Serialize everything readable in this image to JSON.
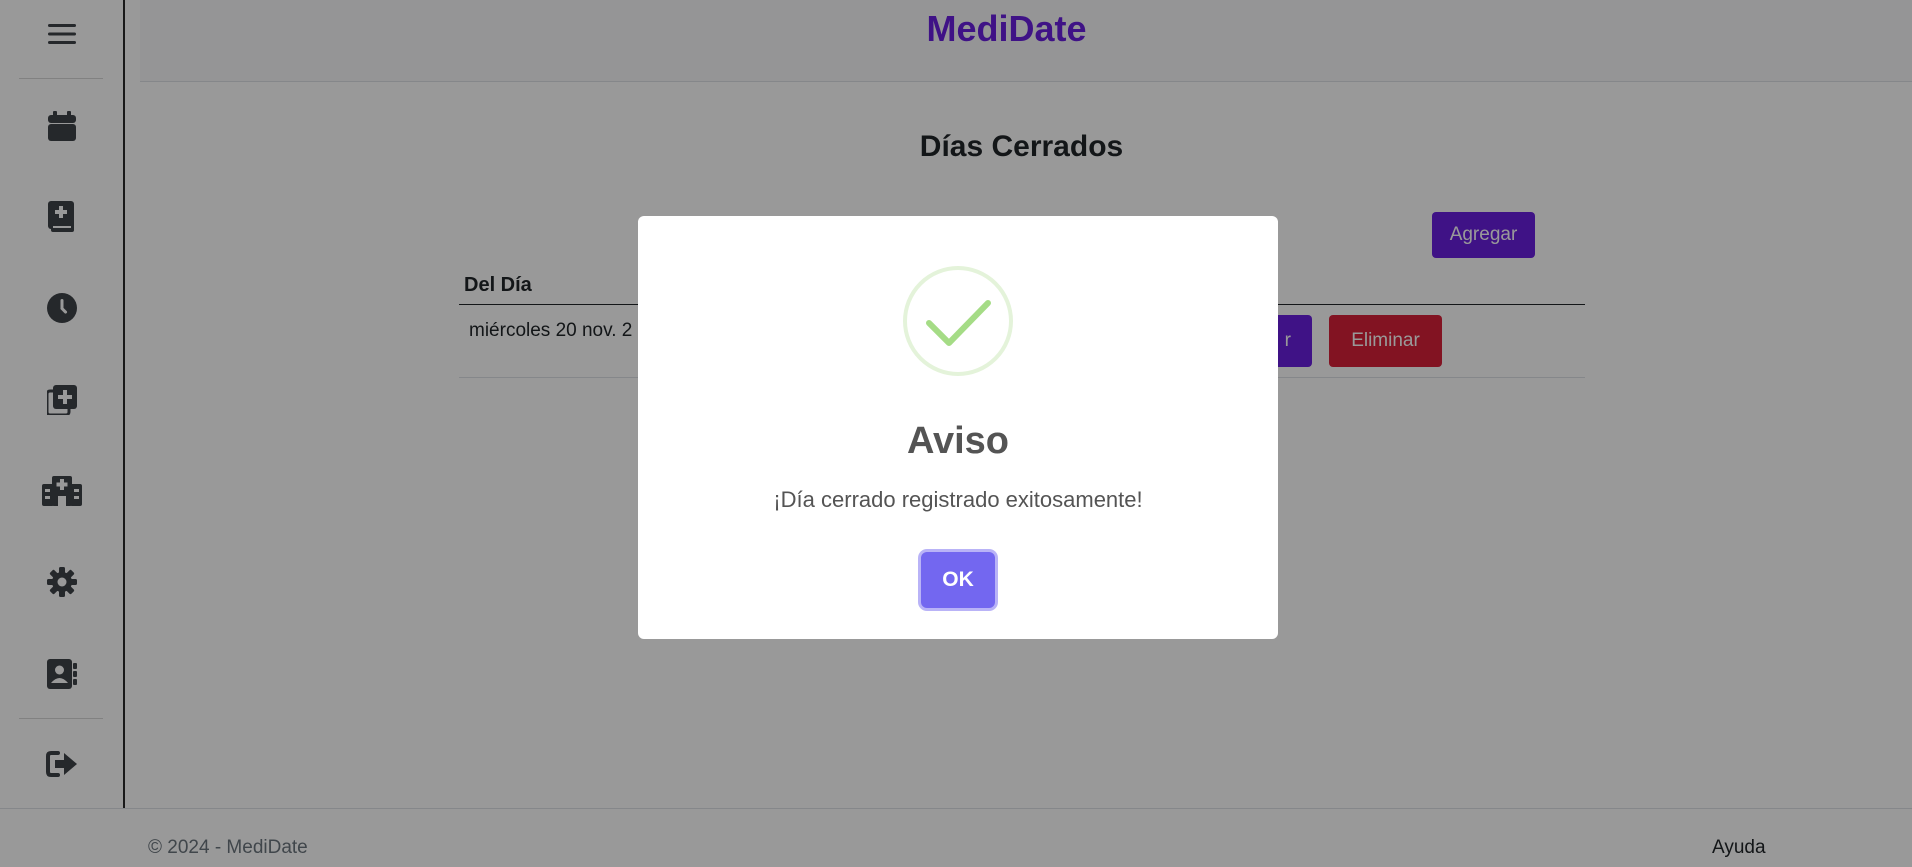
{
  "app": {
    "brand": "MediDate",
    "accent_color": "#6a1fe0",
    "danger_color": "#d9203a"
  },
  "sidebar": {
    "items": [
      {
        "icon": "hamburger-menu-icon"
      },
      {
        "icon": "calendar-icon"
      },
      {
        "icon": "medical-book-icon"
      },
      {
        "icon": "clock-icon"
      },
      {
        "icon": "add-copy-icon"
      },
      {
        "icon": "hospital-icon"
      },
      {
        "icon": "gear-icon"
      },
      {
        "icon": "address-book-icon"
      },
      {
        "icon": "logout-icon"
      }
    ]
  },
  "main": {
    "title": "Días Cerrados",
    "add_button": "Agregar",
    "table": {
      "headers": [
        "Del Día"
      ],
      "rows": [
        {
          "date": "miércoles 20 nov. 2",
          "edit_label": "r",
          "delete_label": "Eliminar"
        }
      ]
    }
  },
  "footer": {
    "copyright": "© 2024 - MediDate",
    "help": "Ayuda"
  },
  "modal": {
    "icon": "success-check-icon",
    "title": "Aviso",
    "message": "¡Día cerrado registrado exitosamente!",
    "ok_label": "OK",
    "ok_color": "#7367f0",
    "check_color": "#a5dc86"
  }
}
